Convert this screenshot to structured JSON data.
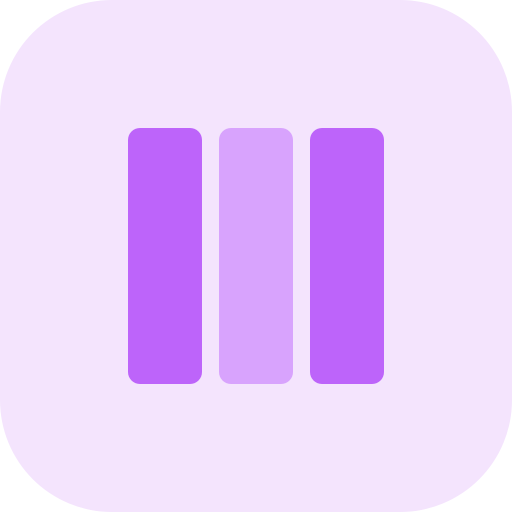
{
  "icon": {
    "name": "columns-icon",
    "colors": {
      "background": "#F4E4FD",
      "primary": "#BD64FA",
      "secondary": "#D8A3FD"
    },
    "columns": [
      {
        "name": "column-left",
        "tone": "primary"
      },
      {
        "name": "column-middle",
        "tone": "secondary"
      },
      {
        "name": "column-right",
        "tone": "primary"
      }
    ]
  }
}
